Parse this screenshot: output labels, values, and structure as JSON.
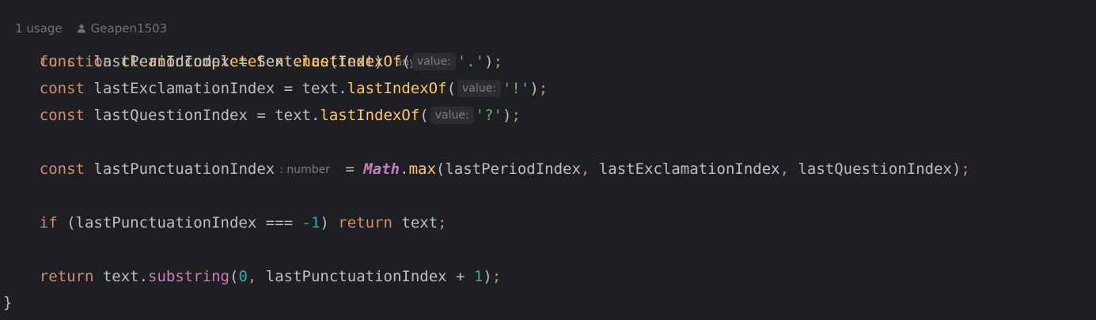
{
  "meta": {
    "usages": "1 usage",
    "author": "Geapen1503"
  },
  "code": {
    "l1_kw": "function",
    "l1_name": "cleanIncompleteSentence",
    "l1_params": "(text)",
    "l1_type": ": any",
    "l1_brace": "{",
    "l2_const": "const",
    "l2_var": "lastPeriodIndex",
    "l2_eq": " = text.",
    "l2_method": "lastIndexOf",
    "l2_open": "(",
    "l2_hint": "value:",
    "l2_str": "'.'",
    "l2_close": ")",
    "l2_semi": ";",
    "l3_const": "const",
    "l3_var": "lastExclamationIndex",
    "l3_eq": " = text.",
    "l3_method": "lastIndexOf",
    "l3_open": "(",
    "l3_hint": "value:",
    "l3_str": "'!'",
    "l3_close": ")",
    "l3_semi": ";",
    "l4_const": "const",
    "l4_var": "lastQuestionIndex",
    "l4_eq": " = text.",
    "l4_method": "lastIndexOf",
    "l4_open": "(",
    "l4_hint": "value:",
    "l4_str": "'?'",
    "l4_close": ")",
    "l4_semi": ";",
    "l5_const": "const",
    "l5_var": "lastPunctuationIndex",
    "l5_type": ": number",
    "l5_eq": " = ",
    "l5_obj": "Math",
    "l5_dot": ".",
    "l5_method": "max",
    "l5_a1": "(lastPeriodIndex",
    "l5_c1": ",",
    "l5_a2": " lastExclamationIndex",
    "l5_c2": ",",
    "l5_a3": " lastQuestionIndex)",
    "l5_semi": ";",
    "l6_if": "if",
    "l6_cond": " (lastPunctuationIndex === ",
    "l6_num": "-1",
    "l6_paren": ") ",
    "l6_return": "return",
    "l6_text": " text",
    "l6_semi": ";",
    "l7_return": "return",
    "l7_text": " text.",
    "l7_method": "substring",
    "l7_open": "(",
    "l7_num0": "0",
    "l7_comma": ",",
    "l7_arg": " lastPunctuationIndex + ",
    "l7_num1": "1",
    "l7_close": ")",
    "l7_semi": ";",
    "l8_brace": "}"
  },
  "colors": {
    "background": "#1e1f22",
    "keyword": "#cf8e6d",
    "function_name": "#56a8f5",
    "method_call": "#ffc66d",
    "string": "#6aab73",
    "number": "#2aacb8",
    "builtin_object": "#c77dbb",
    "hint_text": "#7a7e85"
  },
  "icons": {
    "author": "person-icon"
  }
}
